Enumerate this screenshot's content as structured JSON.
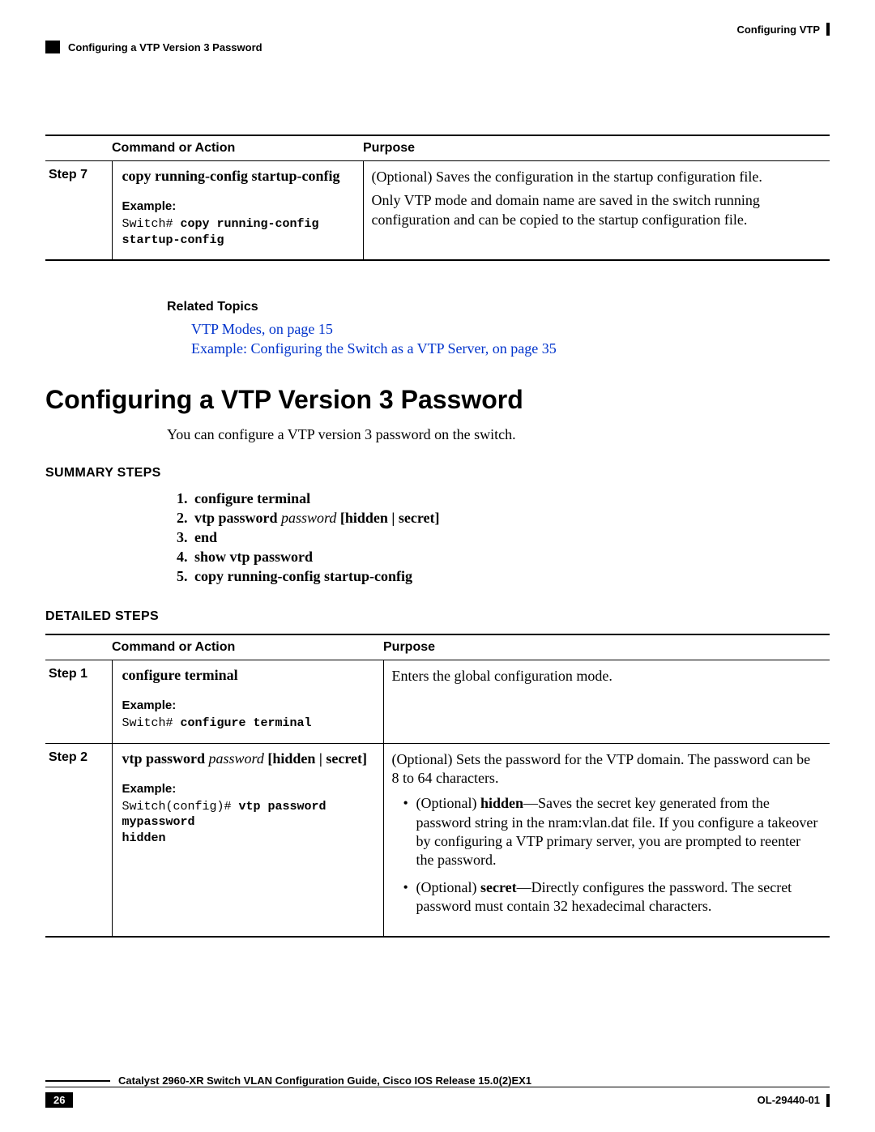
{
  "header": {
    "right": "Configuring VTP",
    "sub": "Configuring a VTP Version 3 Password"
  },
  "table1": {
    "headers": {
      "cmd": "Command or Action",
      "purpose": "Purpose"
    },
    "step_label": "Step 7",
    "cmd": "copy running-config startup-config",
    "example_label": "Example:",
    "example_prefix": "Switch# ",
    "example_cmd": "copy running-config startup-config",
    "purpose_line1": "(Optional) Saves the configuration in the startup configuration file.",
    "purpose_line2": "Only VTP mode and domain name are saved in the switch running configuration and can be copied to the startup configuration file."
  },
  "related": {
    "title": "Related Topics",
    "link1": "VTP Modes, on page 15",
    "link2": "Example: Configuring the Switch as a VTP Server, on page 35"
  },
  "section": {
    "title": "Configuring a VTP Version 3 Password",
    "intro": "You can configure a VTP version 3 password on the switch."
  },
  "summary": {
    "heading": "SUMMARY STEPS",
    "steps": {
      "s1": "configure terminal",
      "s2a": "vtp password ",
      "s2b": "password",
      "s2c": " [hidden | secret]",
      "s3": "end",
      "s4": "show vtp password",
      "s5": "copy running-config startup-config"
    }
  },
  "detailed": {
    "heading": "DETAILED STEPS",
    "headers": {
      "cmd": "Command or Action",
      "purpose": "Purpose"
    },
    "row1": {
      "step": "Step 1",
      "cmd": "configure terminal",
      "example_label": "Example:",
      "example_prefix": "Switch# ",
      "example_cmd": "configure terminal",
      "purpose": "Enters the global configuration mode."
    },
    "row2": {
      "step": "Step 2",
      "cmd_a": "vtp password ",
      "cmd_b": "password",
      "cmd_c": " [hidden | secret]",
      "example_label": "Example:",
      "example_prefix": "Switch(config)# ",
      "example_cmd": "vtp password mypassword hidden",
      "purpose_p": "(Optional) Sets the password for the VTP domain. The password can be 8 to 64 characters.",
      "li1_a": "(Optional) ",
      "li1_b": "hidden",
      "li1_c": "—Saves the secret key generated from the password string in the nram:vlan.dat file. If you configure a takeover by configuring a VTP primary server, you are prompted to reenter the password.",
      "li2_a": "(Optional) ",
      "li2_b": "secret",
      "li2_c": "—Directly configures the password. The secret password must contain 32 hexadecimal characters."
    }
  },
  "footer": {
    "guide": "Catalyst 2960-XR Switch VLAN Configuration Guide, Cisco IOS Release 15.0(2)EX1",
    "page": "26",
    "docid": "OL-29440-01"
  }
}
